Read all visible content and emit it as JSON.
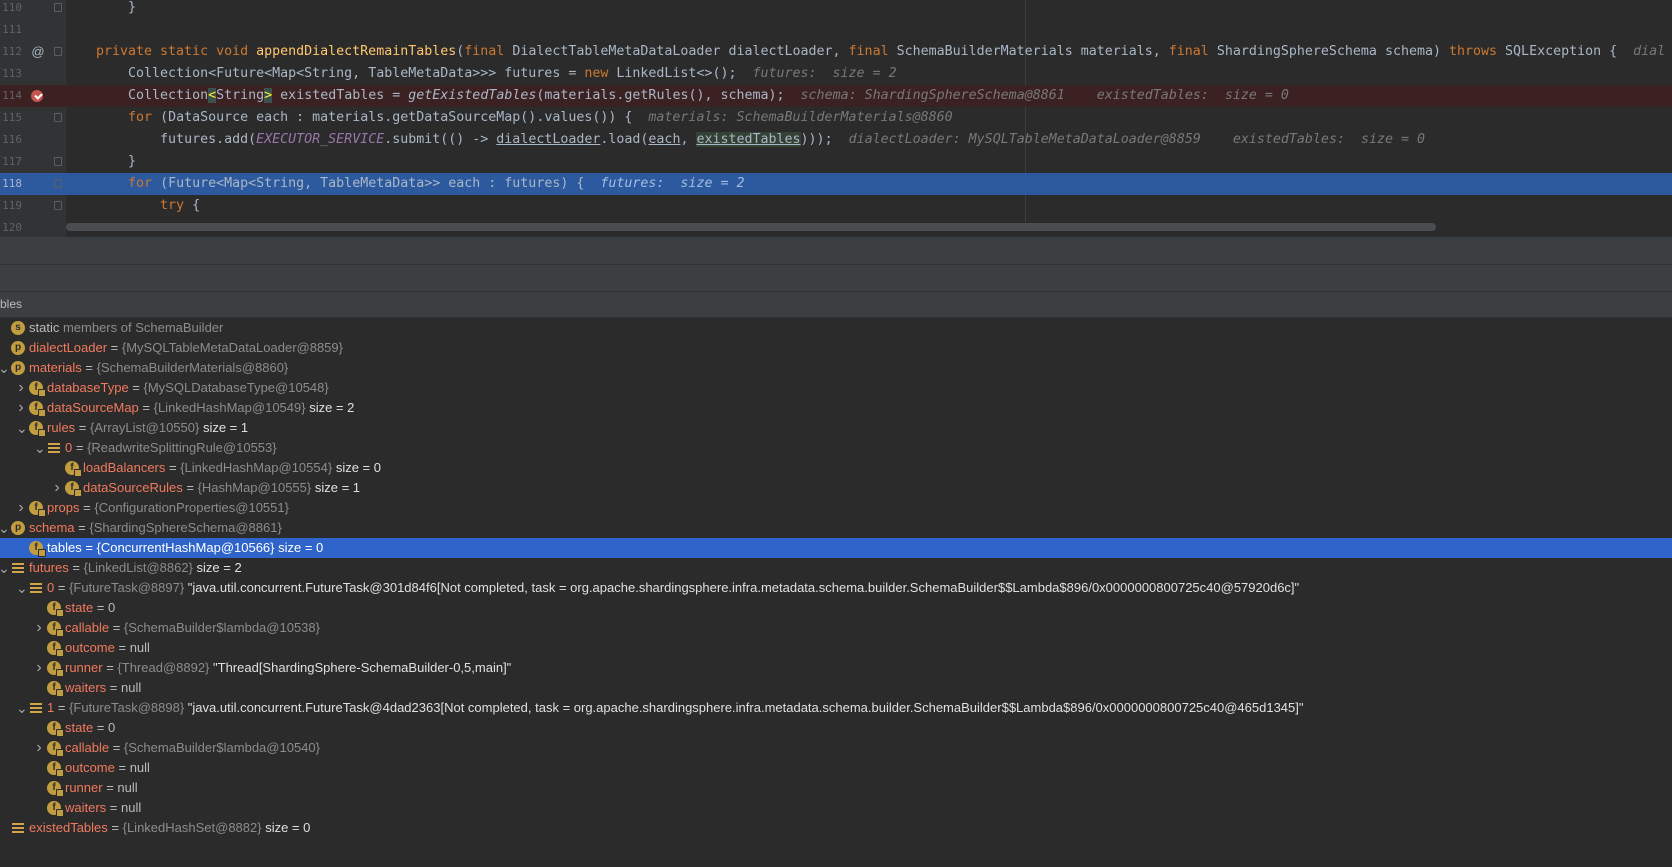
{
  "editor": {
    "lines": [
      {
        "num": "110",
        "code": "}"
      },
      {
        "num": "111",
        "code": ""
      },
      {
        "num": "112",
        "marker": "@",
        "parts": {
          "kw1": "private static void ",
          "fn": "appendDialectRemainTables",
          "p1": "(",
          "kw2": "final ",
          "p2": "DialectTableMetaDataLoader dialectLoader, ",
          "kw3": "final ",
          "p3": "SchemaBuilderMaterials materials, ",
          "kw4": "final ",
          "p4": "ShardingSphereSchema schema) ",
          "kw5": "throws ",
          "p5": "SQLException {",
          "inline": "dial"
        }
      },
      {
        "num": "113",
        "parts": {
          "p1": "Collection<Future<Map<String, TableMetaData>>> futures = ",
          "kw1": "new ",
          "p2": "LinkedList<>();",
          "inline": "futures:  size = 2"
        }
      },
      {
        "num": "114",
        "breakpoint": true,
        "parts": {
          "p1": "Collection",
          "b1": "<",
          "p2": "String",
          "b2": ">",
          "p3": " existedTables = ",
          "it": "getExistedTables",
          "p4": "(materials.getRules(), schema);",
          "inline1": "schema: ShardingSphereSchema@8861",
          "inline2": "existedTables:  size = 0"
        }
      },
      {
        "num": "115",
        "parts": {
          "kw1": "for ",
          "p1": "(DataSource each : materials.getDataSourceMap().values()) {",
          "inline": "materials: SchemaBuilderMaterials@8860"
        }
      },
      {
        "num": "116",
        "parts": {
          "p1": "futures.add(",
          "cst": "EXECUTOR_SERVICE",
          "p2": ".submit(() -> ",
          "u1": "dialectLoader",
          "p3": ".load(",
          "u2": "each",
          "p4": ", ",
          "u3": "existedTables",
          "p5": ")));",
          "inline1": "dialectLoader: MySQLTableMetaDataLoader@8859",
          "inline2": "existedTables:  size = 0"
        }
      },
      {
        "num": "117",
        "code": "}"
      },
      {
        "num": "118",
        "parts": {
          "kw1": "for ",
          "p1": "(Future<Map<String, TableMetaData>> each : futures) {",
          "inline": "futures:  size = 2"
        }
      },
      {
        "num": "119",
        "parts": {
          "kw1": "try ",
          "p1": "{"
        }
      },
      {
        "num": "120",
        "code": ""
      }
    ]
  },
  "variables_panel": {
    "header": "bles"
  },
  "variables": [
    {
      "icon": "s",
      "name": "static",
      "rest": " members of SchemaBuilder",
      "arrow": ""
    },
    {
      "icon": "p",
      "name": "dialectLoader",
      "eq": " = ",
      "type": "{MySQLTableMetaDataLoader@8859}",
      "arrow": ""
    },
    {
      "icon": "p",
      "name": "materials",
      "eq": " = ",
      "type": "{SchemaBuilderMaterials@8860}",
      "arrow": "open"
    },
    {
      "icon": "f",
      "name": "databaseType",
      "eq": " = ",
      "type": "{MySQLDatabaseType@10548}",
      "arrow": "closed"
    },
    {
      "icon": "f",
      "name": "dataSourceMap",
      "eq": " = ",
      "type": "{LinkedHashMap@10549}",
      "extra": "  size = 2",
      "arrow": "closed"
    },
    {
      "icon": "f",
      "name": "rules",
      "eq": " = ",
      "type": "{ArrayList@10550}",
      "extra": "  size = 1",
      "arrow": "open"
    },
    {
      "icon": "arr",
      "name": "0",
      "eq": " = ",
      "type": "{ReadwriteSplittingRule@10553}",
      "arrow": "open"
    },
    {
      "icon": "f",
      "name": "loadBalancers",
      "eq": " = ",
      "type": "{LinkedHashMap@10554}",
      "extra": "  size = 0",
      "arrow": ""
    },
    {
      "icon": "f",
      "name": "dataSourceRules",
      "eq": " = ",
      "type": "{HashMap@10555}",
      "extra": "  size = 1",
      "arrow": "closed"
    },
    {
      "icon": "f",
      "name": "props",
      "eq": " = ",
      "type": "{ConfigurationProperties@10551}",
      "arrow": "closed"
    },
    {
      "icon": "p",
      "name": "schema",
      "eq": " = ",
      "type": "{ShardingSphereSchema@8861}",
      "arrow": "open"
    },
    {
      "icon": "f",
      "name": "tables",
      "eq": " = ",
      "type": "{ConcurrentHashMap@10566}",
      "extra": "  size = 0",
      "arrow": "",
      "selected": true
    },
    {
      "icon": "arr",
      "name": "futures",
      "eq": " = ",
      "type": "{LinkedList@8862}",
      "extra": "  size = 2",
      "arrow": "open"
    },
    {
      "icon": "arr",
      "name": "0",
      "eq": " = ",
      "type": "{FutureTask@8897}",
      "extra": " \"java.util.concurrent.FutureTask@301d84f6[Not completed, task = org.apache.shardingsphere.infra.metadata.schema.builder.SchemaBuilder$$Lambda$896/0x0000000800725c40@57920d6c]\"",
      "arrow": "open"
    },
    {
      "icon": "f",
      "name": "state",
      "eq": " = ",
      "value": "0",
      "arrow": ""
    },
    {
      "icon": "f",
      "name": "callable",
      "eq": " = ",
      "type": "{SchemaBuilder$lambda@10538}",
      "arrow": "closed"
    },
    {
      "icon": "f",
      "name": "outcome",
      "eq": " = ",
      "value": "null",
      "arrow": ""
    },
    {
      "icon": "f",
      "name": "runner",
      "eq": " = ",
      "type": "{Thread@8892}",
      "extra": " \"Thread[ShardingSphere-SchemaBuilder-0,5,main]\"",
      "arrow": "closed"
    },
    {
      "icon": "f",
      "name": "waiters",
      "eq": " = ",
      "value": "null",
      "arrow": ""
    },
    {
      "icon": "arr",
      "name": "1",
      "eq": " = ",
      "type": "{FutureTask@8898}",
      "extra": " \"java.util.concurrent.FutureTask@4dad2363[Not completed, task = org.apache.shardingsphere.infra.metadata.schema.builder.SchemaBuilder$$Lambda$896/0x0000000800725c40@465d1345]\"",
      "arrow": "open"
    },
    {
      "icon": "f",
      "name": "state",
      "eq": " = ",
      "value": "0",
      "arrow": ""
    },
    {
      "icon": "f",
      "name": "callable",
      "eq": " = ",
      "type": "{SchemaBuilder$lambda@10540}",
      "arrow": "closed"
    },
    {
      "icon": "f",
      "name": "outcome",
      "eq": " = ",
      "value": "null",
      "arrow": ""
    },
    {
      "icon": "f",
      "name": "runner",
      "eq": " = ",
      "value": "null",
      "arrow": ""
    },
    {
      "icon": "f",
      "name": "waiters",
      "eq": " = ",
      "value": "null",
      "arrow": ""
    },
    {
      "icon": "arr",
      "name": "existedTables",
      "eq": " = ",
      "type": "{LinkedHashSet@8882}",
      "extra": "  size = 0",
      "arrow": ""
    }
  ]
}
